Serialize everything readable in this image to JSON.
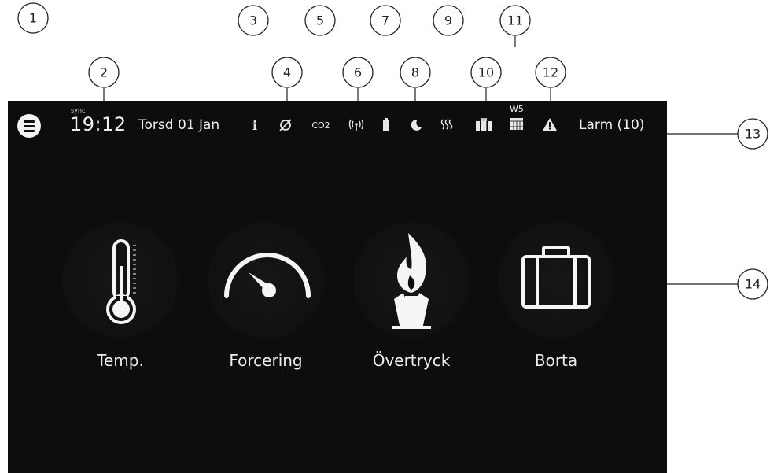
{
  "callouts": [
    "1",
    "2",
    "3",
    "4",
    "5",
    "6",
    "7",
    "8",
    "9",
    "10",
    "11",
    "12",
    "13",
    "14"
  ],
  "status": {
    "sync_label": "sync",
    "time": "19:12",
    "date": "Torsd 01 Jan",
    "info_icon": "i",
    "co2_label": "CO2",
    "week_label": "W5",
    "alarm_label": "Larm (10)"
  },
  "icons": {
    "menu": "menu-icon",
    "info": "info-icon",
    "no_sync": "no-sync-icon",
    "co2": "co2-icon",
    "wireless": "wireless-icon",
    "battery": "battery-icon",
    "night": "moon-icon",
    "heat": "heat-icon",
    "away": "suitcase-icon",
    "calendar": "calendar-icon",
    "warning": "warning-icon"
  },
  "tiles": [
    {
      "label": "Temp.",
      "icon": "thermometer-icon"
    },
    {
      "label": "Forcering",
      "icon": "speedometer-icon"
    },
    {
      "label": "Övertryck",
      "icon": "fireplace-icon"
    },
    {
      "label": "Borta",
      "icon": "suitcase-icon"
    }
  ],
  "colors": {
    "screen_bg": "#0d0d0d",
    "foreground": "#f0f0f0"
  }
}
